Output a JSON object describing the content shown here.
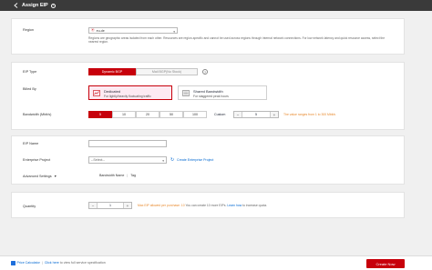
{
  "header": {
    "title": "Assign EIP"
  },
  "region": {
    "label": "Region",
    "value": "eu-de",
    "note": "Regions are geographic areas isolated from each other. Resources are region-specific and cannot be used across regions through internal network connections. For low network latency and quick resource access, select the nearest region."
  },
  "eip_type": {
    "label": "EIP Type",
    "options": [
      "Dynamic BGP",
      "Mail BGP(No Stock)"
    ],
    "selected": "Dynamic BGP"
  },
  "billed_by": {
    "label": "Billed By",
    "cards": [
      {
        "title": "Dedicated",
        "subtitle": "For lightly/heavily fluctuating traffic"
      },
      {
        "title": "Shared Bandwidth",
        "subtitle": "For staggered peak hours"
      }
    ],
    "selected": "Dedicated"
  },
  "bandwidth": {
    "label": "Bandwidth (Mbit/s)",
    "options": [
      "5",
      "10",
      "20",
      "50",
      "100"
    ],
    "selected": "5",
    "custom_label": "Custom",
    "value": "5",
    "warning": "The value ranges from 1 to 300 Mbit/s"
  },
  "eip_name": {
    "label": "EIP Name",
    "value": ""
  },
  "enterprise_project": {
    "label": "Enterprise Project",
    "placeholder": "--Select--",
    "create_link": "Create Enterprise Project"
  },
  "advanced": {
    "label": "Advanced Settings",
    "summary": [
      "Bandwidth Name",
      "Tag"
    ]
  },
  "quantity": {
    "label": "Quantity",
    "value": "1",
    "warning": "Max EIP allowed per purchase: 10",
    "info": "You can create 10 more EIPs.",
    "link": "Learn how",
    "suffix": "to increase quota."
  },
  "footer": {
    "price_calc": "Price Calculator",
    "click_here": "Click here",
    "tail": "to view full service specification",
    "create_button": "Create Now"
  },
  "colors": {
    "accent": "#c7000b",
    "link": "#0067d1",
    "warning": "#e88a2e",
    "header_bg": "#3a3a3a"
  }
}
